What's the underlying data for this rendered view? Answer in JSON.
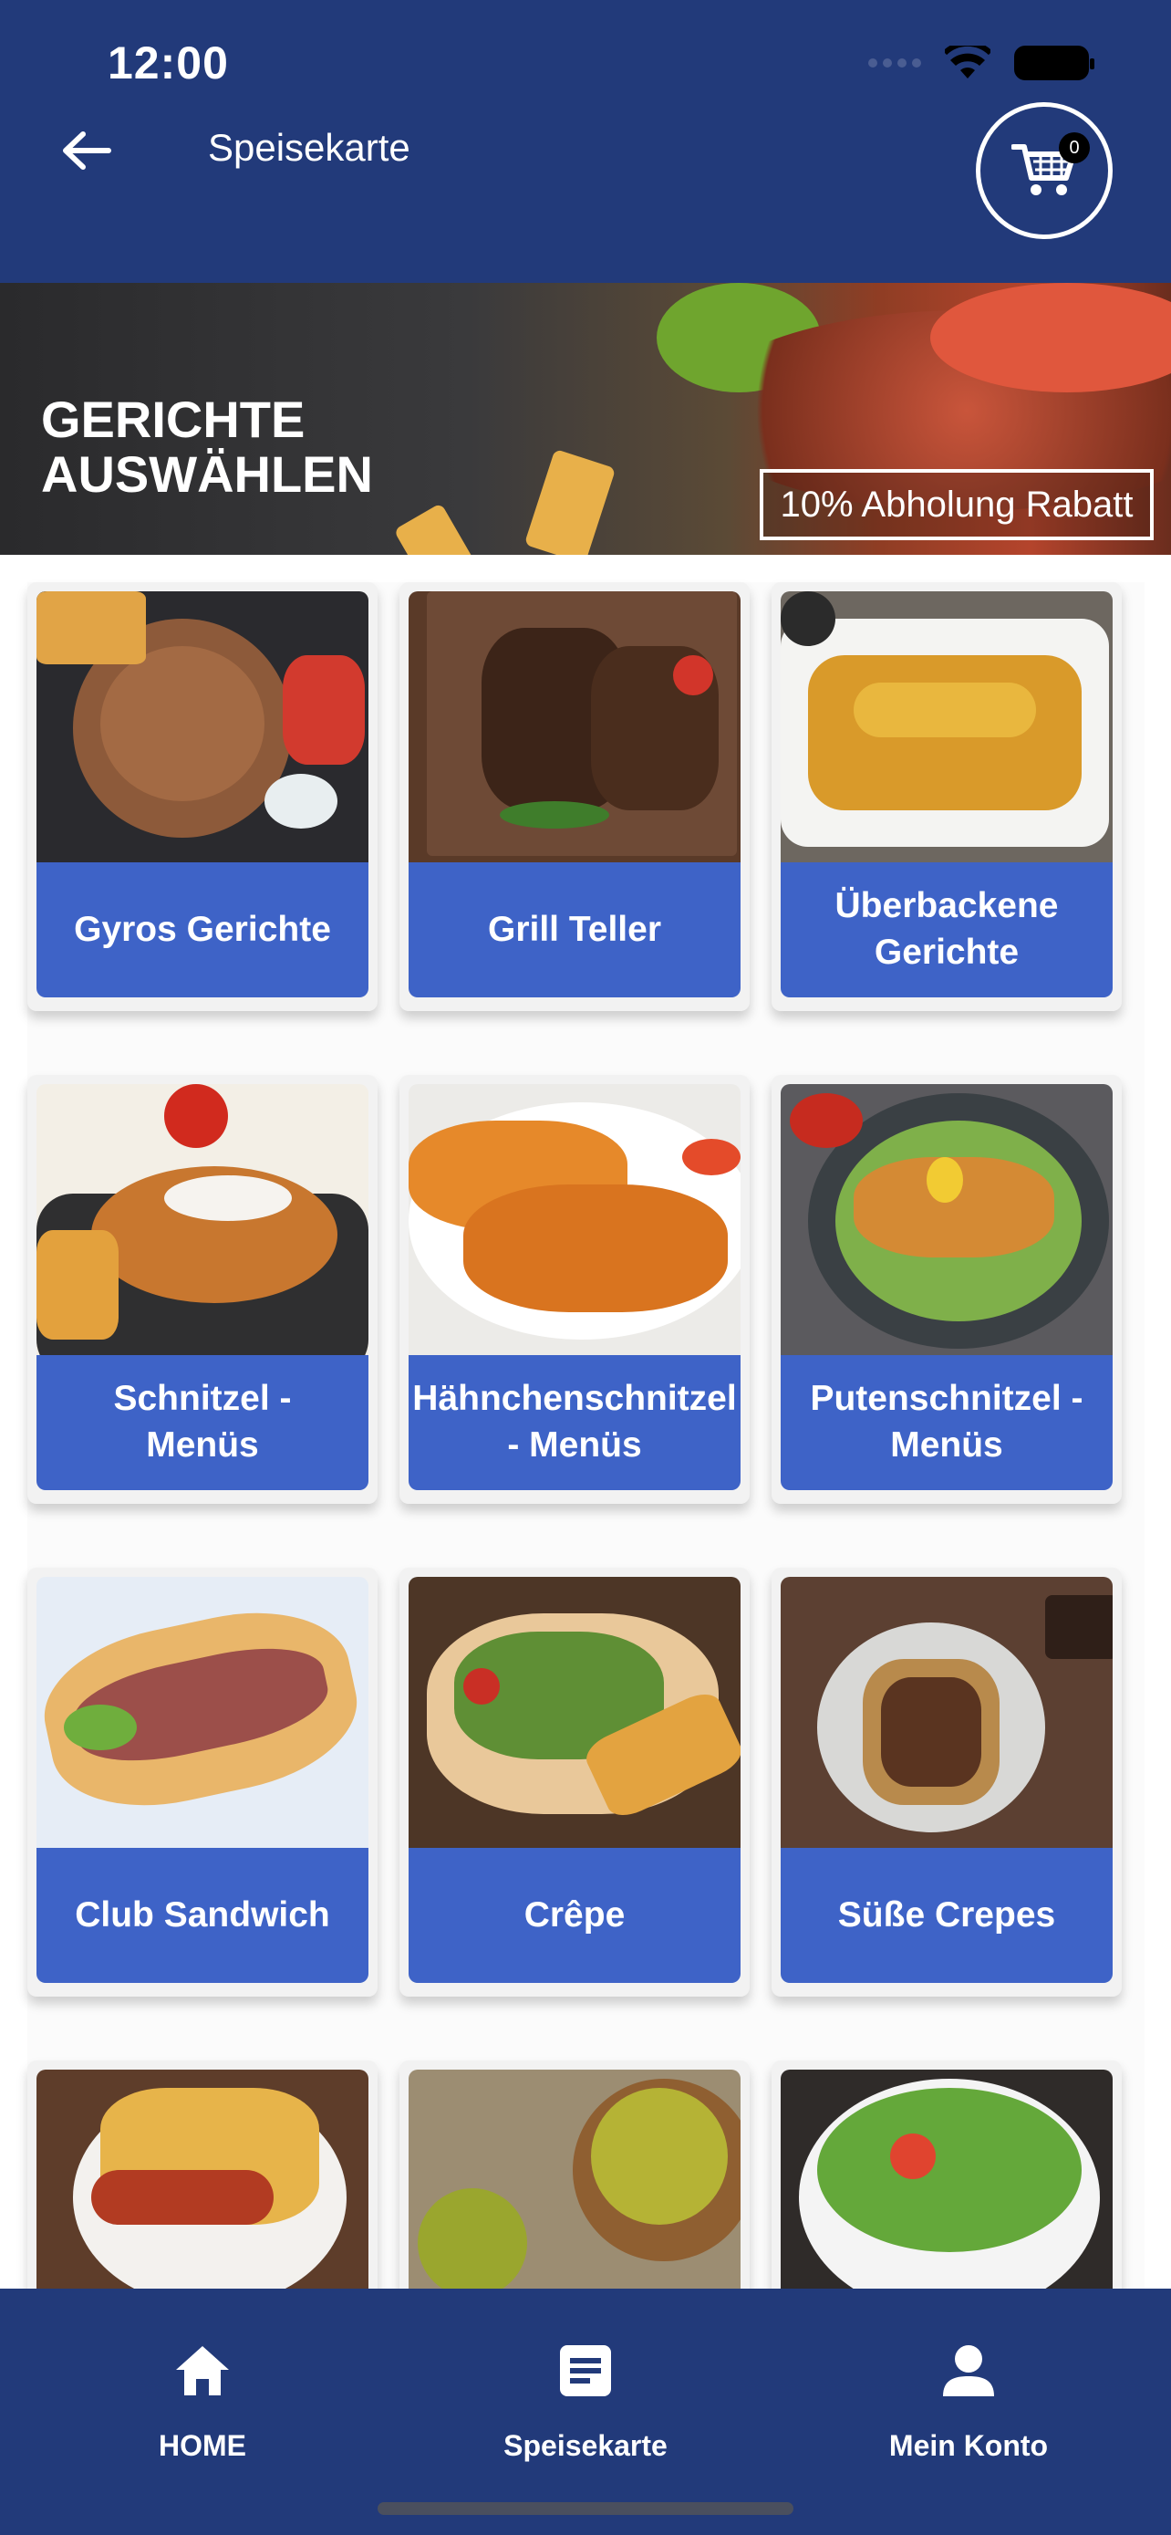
{
  "status_bar": {
    "time": "12:00"
  },
  "header": {
    "title": "Speisekarte",
    "cart_count": "0"
  },
  "banner": {
    "title_line1": "GERICHTE",
    "title_line2": "AUSWÄHLEN",
    "promo": "10% Abholung Rabatt"
  },
  "categories": [
    {
      "label": "Gyros Gerichte"
    },
    {
      "label": "Grill Teller"
    },
    {
      "label": "Überbackene Gerichte"
    },
    {
      "label": "Schnitzel - Menüs"
    },
    {
      "label": "Hähnchenschnitzel - Menüs"
    },
    {
      "label": "Putenschnitzel - Menüs"
    },
    {
      "label": "Club Sandwich"
    },
    {
      "label": "Crêpe"
    },
    {
      "label": "Süße Crepes"
    }
  ],
  "bottom_nav": {
    "home": "HOME",
    "menu": "Speisekarte",
    "account": "Mein Konto"
  },
  "colors": {
    "primary": "#223a7a",
    "card_label": "#3e63c7"
  },
  "icons": [
    "back-arrow-icon",
    "cart-icon",
    "home-icon",
    "menu-list-icon",
    "account-icon",
    "wifi-icon",
    "battery-icon"
  ]
}
